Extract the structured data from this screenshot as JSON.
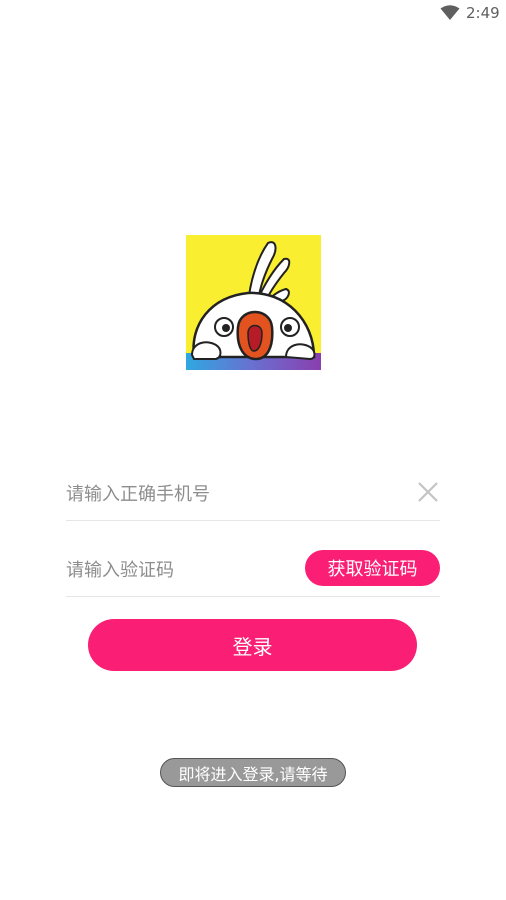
{
  "status_bar": {
    "time": "2:49",
    "wifi_icon": "wifi-icon"
  },
  "logo": {
    "icon": "app-logo-bird-icon",
    "colors": {
      "background": "#f9ee2f",
      "gradient_left": "#2fa8e0",
      "gradient_right": "#8a3fae"
    }
  },
  "login_form": {
    "phone_placeholder": "请输入正确手机号",
    "phone_value": "",
    "clear_icon": "close-icon",
    "code_placeholder": "请输入验证码",
    "code_value": "",
    "get_code_label": "获取验证码",
    "login_label": "登录"
  },
  "toast": {
    "message": "即将进入登录,请等待"
  },
  "colors": {
    "accent": "#fa1e74",
    "toast_bg": "#999999"
  }
}
